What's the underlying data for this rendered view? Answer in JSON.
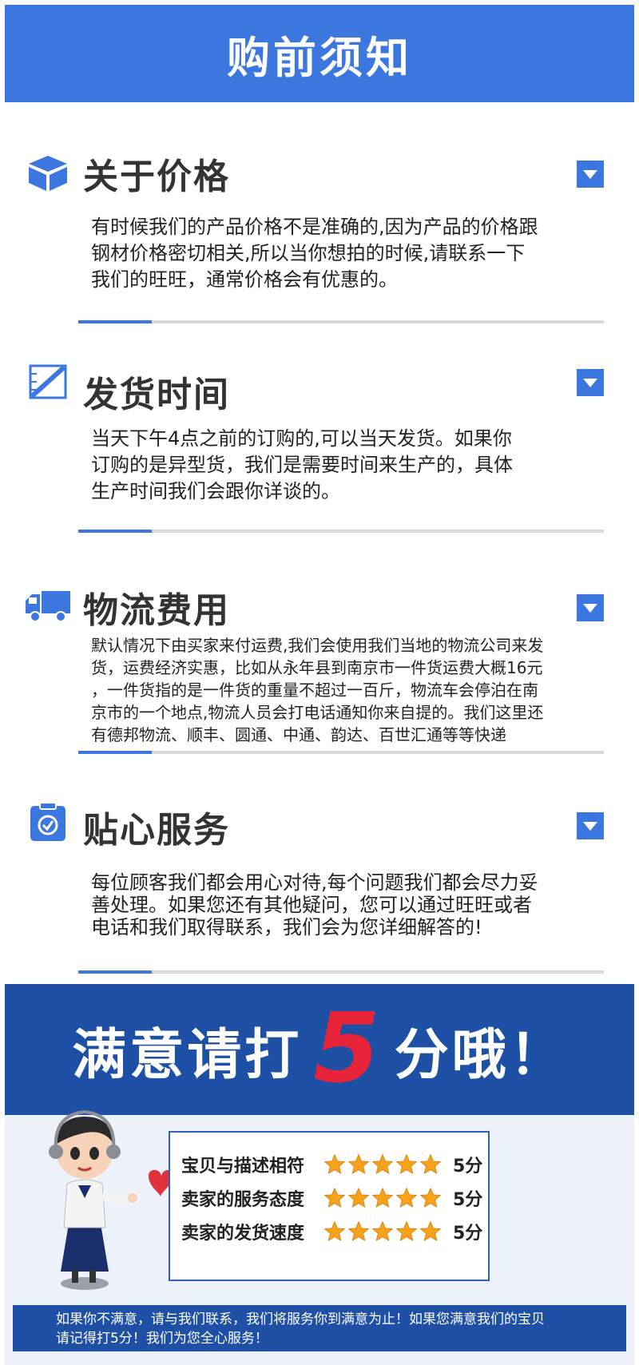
{
  "header": {
    "title": "购前须知"
  },
  "sections": [
    {
      "title": "关于价格",
      "icon": "cube-icon",
      "body": [
        "有时候我们的产品价格不是准确的,因为产品的价格跟",
        "钢材价格密切相关,所以当你想拍的时候,请联系一下",
        "我们的旺旺，通常价格会有优惠的。"
      ]
    },
    {
      "title": "发货时间",
      "icon": "ruler-pencil-icon",
      "body": [
        "当天下午4点之前的订购的,可以当天发货。如果你",
        "订购的是异型货，我们是需要时间来生产的，具体",
        "生产时间我们会跟你详谈的。"
      ]
    },
    {
      "title": "物流费用",
      "icon": "truck-icon",
      "body": [
        "默认情况下由买家来付运费,我们会使用我们当地的物流公司来发",
        "货，运费经济实惠，比如从永年县到南京市一件货运费大概16元",
        "，一件货指的是一件货的重量不超过一百斤，物流车会停泊在南",
        "京市的一个地点,物流人员会打电话通知你来自提的。我们这里还",
        "有德邦物流、顺丰、圆通、中通、韵达、百世汇通等等快递"
      ]
    },
    {
      "title": "贴心服务",
      "icon": "clipboard-check-icon",
      "body": [
        "每位顾客我们都会用心对待,每个问题我们都会尽力妥",
        "善处理。如果您还有其他疑问，您可以通过旺旺或者",
        "电话和我们取得联系，我们会为您详细解答的!"
      ]
    }
  ],
  "rating": {
    "banner_prefix": "满意请打",
    "banner_number": "5",
    "banner_suffix": "分哦！",
    "rows": [
      {
        "label": "宝贝与描述相符",
        "stars": 5,
        "score": "5分"
      },
      {
        "label": "卖家的服务态度",
        "stars": 5,
        "score": "5分"
      },
      {
        "label": "卖家的发货速度",
        "stars": 5,
        "score": "5分"
      }
    ],
    "footer_lines": [
      "如果你不满意，请与我们联系，我们将服务你到满意为止！如果您满意我们的宝贝",
      "请记得打5分！我们为您全心服务！"
    ]
  },
  "colors": {
    "accent": "#3b77df",
    "banner": "#1e51a6",
    "five": "#e8243a",
    "star": "#f7a21b"
  }
}
